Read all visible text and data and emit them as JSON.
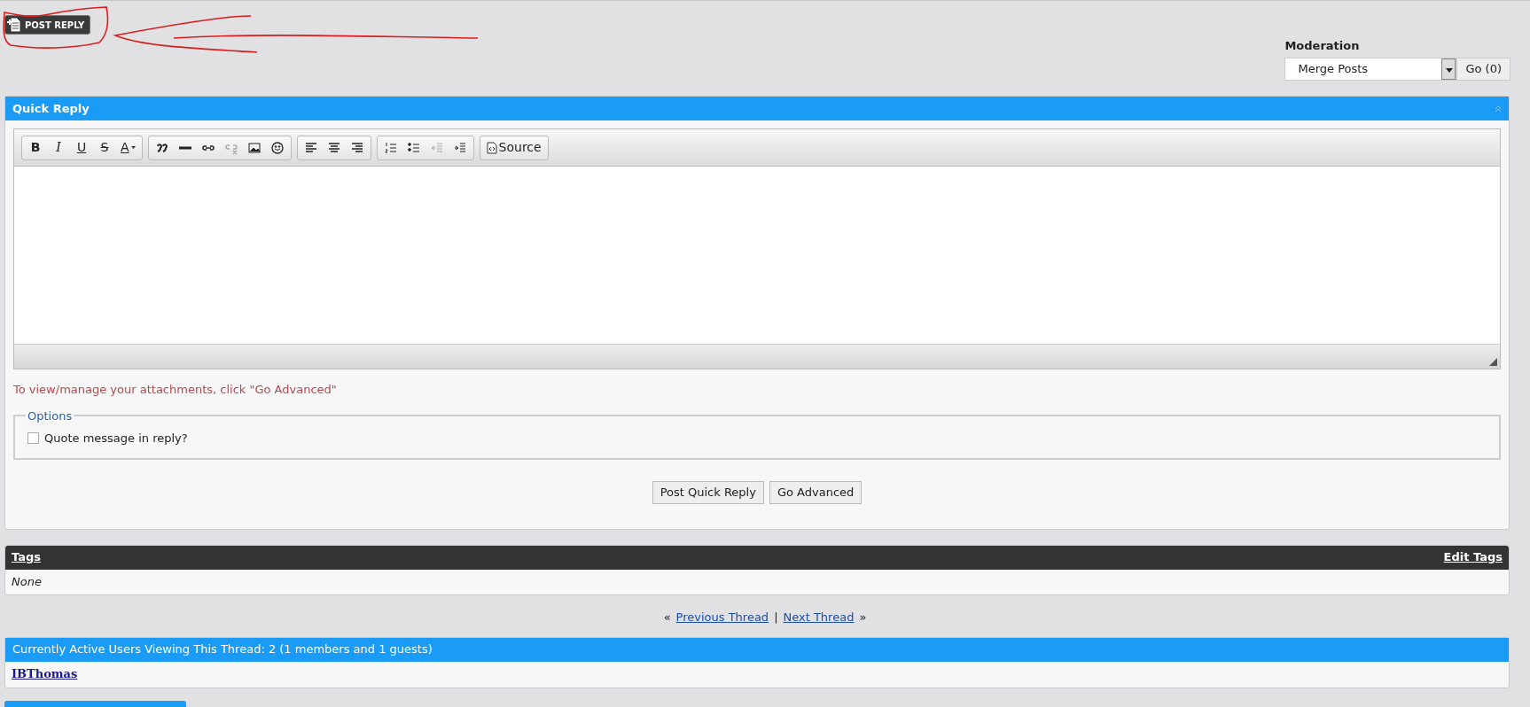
{
  "post_reply_button": {
    "label": "POST REPLY"
  },
  "moderation": {
    "title": "Moderation",
    "select_value": "Merge Posts",
    "go_button": "Go (0)"
  },
  "quick_reply": {
    "title": "Quick Reply",
    "toolbar": [
      [
        {
          "kind": "bold",
          "label": "B",
          "disabled": false
        },
        {
          "kind": "italic",
          "label": "I",
          "disabled": false
        },
        {
          "kind": "underline",
          "label": "U",
          "disabled": false
        },
        {
          "kind": "strike",
          "label": "S",
          "disabled": false
        },
        {
          "kind": "font_color",
          "label": "A",
          "disabled": false
        }
      ],
      [
        {
          "kind": "quote",
          "disabled": false
        },
        {
          "kind": "rule",
          "disabled": false
        },
        {
          "kind": "link",
          "disabled": false
        },
        {
          "kind": "unlink",
          "disabled": true
        },
        {
          "kind": "image",
          "disabled": false
        },
        {
          "kind": "smiley",
          "disabled": false
        }
      ],
      [
        {
          "kind": "align_left",
          "disabled": false
        },
        {
          "kind": "align_center",
          "disabled": false
        },
        {
          "kind": "align_right",
          "disabled": false
        }
      ],
      [
        {
          "kind": "ordered_list",
          "disabled": false
        },
        {
          "kind": "bullet_list",
          "disabled": false
        },
        {
          "kind": "outdent",
          "disabled": true
        },
        {
          "kind": "indent",
          "disabled": false
        }
      ],
      [
        {
          "kind": "source",
          "label": "Source",
          "disabled": false
        }
      ]
    ],
    "attachments_note": "To view/manage your attachments, click \"Go Advanced\"",
    "options": {
      "legend": "Options",
      "checkbox": {
        "label": "Quote message in reply?",
        "checked": false
      }
    },
    "buttons": [
      "Post Quick Reply",
      "Go Advanced"
    ]
  },
  "tags": {
    "title": "Tags",
    "edit_link": "Edit Tags",
    "value": "None"
  },
  "thread_nav": {
    "prev_marker": "«",
    "prev": "Previous Thread",
    "separator": "|",
    "next": "Next Thread",
    "next_marker": "»"
  },
  "active_users": {
    "title": "Currently Active Users Viewing This Thread: 2 (1 members and 1 guests)",
    "users": [
      "IBThomas"
    ]
  }
}
